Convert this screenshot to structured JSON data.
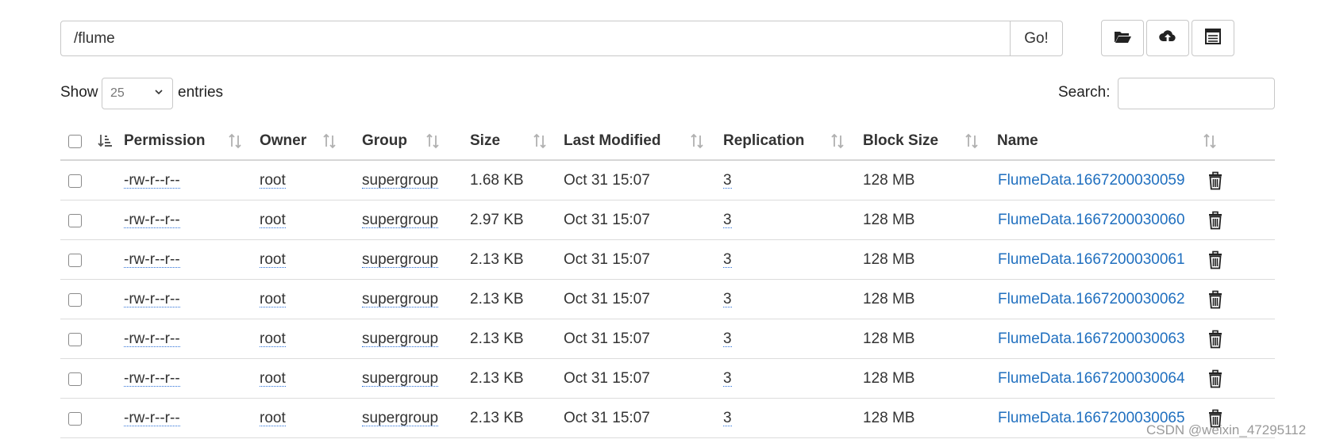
{
  "path_bar": {
    "value": "/flume",
    "go_label": "Go!"
  },
  "toolbar": {
    "icons": [
      "folder-open-icon",
      "cloud-upload-icon",
      "list-icon"
    ]
  },
  "entries": {
    "show_label": "Show",
    "page_size": "25",
    "entries_label": "entries"
  },
  "search": {
    "label": "Search:",
    "value": ""
  },
  "table": {
    "columns": {
      "permission": "Permission",
      "owner": "Owner",
      "group": "Group",
      "size": "Size",
      "last_modified": "Last Modified",
      "replication": "Replication",
      "block_size": "Block Size",
      "name": "Name"
    },
    "rows": [
      {
        "permission": "-rw-r--r--",
        "owner": "root",
        "group": "supergroup",
        "size": "1.68 KB",
        "last_modified": "Oct 31 15:07",
        "replication": "3",
        "block_size": "128 MB",
        "name": "FlumeData.1667200030059"
      },
      {
        "permission": "-rw-r--r--",
        "owner": "root",
        "group": "supergroup",
        "size": "2.97 KB",
        "last_modified": "Oct 31 15:07",
        "replication": "3",
        "block_size": "128 MB",
        "name": "FlumeData.1667200030060"
      },
      {
        "permission": "-rw-r--r--",
        "owner": "root",
        "group": "supergroup",
        "size": "2.13 KB",
        "last_modified": "Oct 31 15:07",
        "replication": "3",
        "block_size": "128 MB",
        "name": "FlumeData.1667200030061"
      },
      {
        "permission": "-rw-r--r--",
        "owner": "root",
        "group": "supergroup",
        "size": "2.13 KB",
        "last_modified": "Oct 31 15:07",
        "replication": "3",
        "block_size": "128 MB",
        "name": "FlumeData.1667200030062"
      },
      {
        "permission": "-rw-r--r--",
        "owner": "root",
        "group": "supergroup",
        "size": "2.13 KB",
        "last_modified": "Oct 31 15:07",
        "replication": "3",
        "block_size": "128 MB",
        "name": "FlumeData.1667200030063"
      },
      {
        "permission": "-rw-r--r--",
        "owner": "root",
        "group": "supergroup",
        "size": "2.13 KB",
        "last_modified": "Oct 31 15:07",
        "replication": "3",
        "block_size": "128 MB",
        "name": "FlumeData.1667200030064"
      },
      {
        "permission": "-rw-r--r--",
        "owner": "root",
        "group": "supergroup",
        "size": "2.13 KB",
        "last_modified": "Oct 31 15:07",
        "replication": "3",
        "block_size": "128 MB",
        "name": "FlumeData.1667200030065"
      }
    ]
  },
  "colors": {
    "link": "#1f6fbf",
    "border": "#c8c8c8",
    "sort_icon": "#b0b0b0"
  },
  "watermark": "CSDN @weixin_47295112"
}
